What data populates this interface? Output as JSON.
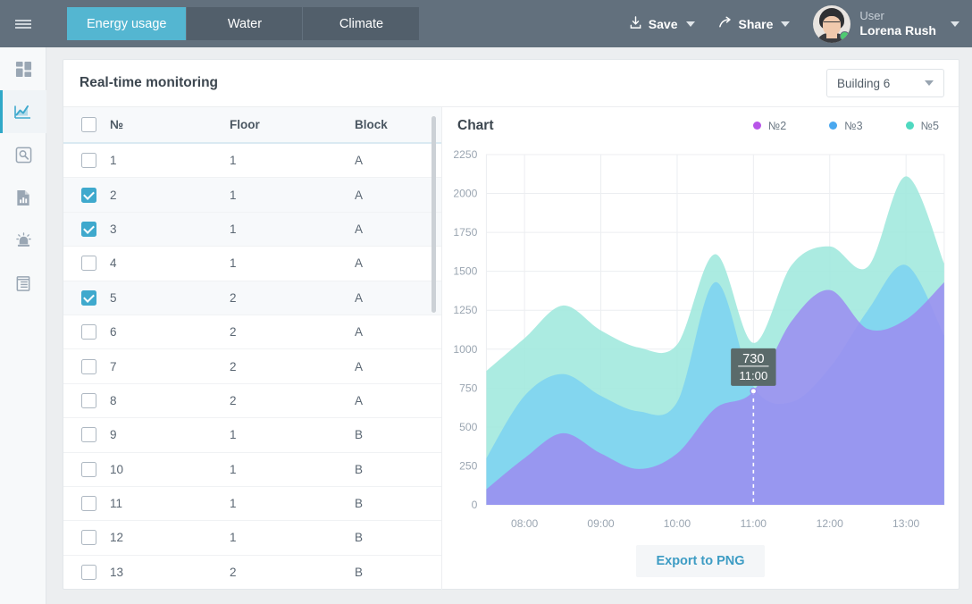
{
  "header": {
    "menu_icon": "hamburger-icon",
    "tabs": [
      {
        "label": "Energy usage",
        "active": true
      },
      {
        "label": "Water",
        "active": false
      },
      {
        "label": "Climate",
        "active": false
      }
    ],
    "save_label": "Save",
    "save_icon": "download-icon",
    "share_label": "Share",
    "share_icon": "share-arrow-icon",
    "user_role": "User",
    "user_name": "Lorena Rush",
    "status": "online"
  },
  "sidebar": {
    "items": [
      {
        "name": "dashboard",
        "icon": "grid-dashboard-icon",
        "active": false
      },
      {
        "name": "analytics",
        "icon": "line-chart-icon",
        "active": true
      },
      {
        "name": "search",
        "icon": "magnifier-search-icon",
        "active": false
      },
      {
        "name": "reports",
        "icon": "document-chart-icon",
        "active": false
      },
      {
        "name": "alerts",
        "icon": "alarm-bell-icon",
        "active": false
      },
      {
        "name": "registry",
        "icon": "list-table-icon",
        "active": false
      }
    ]
  },
  "panel": {
    "title": "Real-time monitoring",
    "building_selected": "Building 6",
    "building_caret": "chevron-down-icon"
  },
  "table": {
    "columns": [
      "№",
      "Floor",
      "Block"
    ],
    "header_checkbox": false,
    "rows": [
      {
        "no": "1",
        "floor": "1",
        "block": "A",
        "checked": false
      },
      {
        "no": "2",
        "floor": "1",
        "block": "A",
        "checked": true
      },
      {
        "no": "3",
        "floor": "1",
        "block": "A",
        "checked": true
      },
      {
        "no": "4",
        "floor": "1",
        "block": "A",
        "checked": false
      },
      {
        "no": "5",
        "floor": "2",
        "block": "A",
        "checked": true
      },
      {
        "no": "6",
        "floor": "2",
        "block": "A",
        "checked": false
      },
      {
        "no": "7",
        "floor": "2",
        "block": "A",
        "checked": false
      },
      {
        "no": "8",
        "floor": "2",
        "block": "A",
        "checked": false
      },
      {
        "no": "9",
        "floor": "1",
        "block": "B",
        "checked": false
      },
      {
        "no": "10",
        "floor": "1",
        "block": "B",
        "checked": false
      },
      {
        "no": "11",
        "floor": "1",
        "block": "B",
        "checked": false
      },
      {
        "no": "12",
        "floor": "1",
        "block": "B",
        "checked": false
      },
      {
        "no": "13",
        "floor": "2",
        "block": "B",
        "checked": false
      }
    ]
  },
  "chart_panel": {
    "title": "Chart",
    "export_label": "Export to PNG"
  },
  "chart_data": {
    "type": "area",
    "title": "Chart",
    "xlabel": "",
    "ylabel": "",
    "ylim": [
      0,
      2250
    ],
    "yticks": [
      0,
      250,
      500,
      750,
      1000,
      1250,
      1500,
      1750,
      2000,
      2250
    ],
    "grid": true,
    "legend_position": "top-right",
    "stacked": false,
    "x": [
      "07:30",
      "08:00",
      "08:30",
      "09:00",
      "09:30",
      "10:00",
      "10:30",
      "11:00",
      "11:30",
      "12:00",
      "12:30",
      "13:00",
      "13:30"
    ],
    "xticks": [
      "08:00",
      "09:00",
      "10:00",
      "11:00",
      "12:00",
      "13:00"
    ],
    "series": [
      {
        "name": "№2",
        "color": "#b855e8",
        "fill": "#9b8ef0",
        "values": [
          100,
          300,
          460,
          330,
          230,
          330,
          620,
          730,
          1180,
          1380,
          1130,
          1190,
          1430
        ]
      },
      {
        "name": "№3",
        "color": "#4aa8ef",
        "fill": "#7dd3f0",
        "values": [
          300,
          700,
          840,
          700,
          600,
          660,
          1430,
          760,
          660,
          880,
          1250,
          1540,
          1090
        ]
      },
      {
        "name": "№5",
        "color": "#4fd9c0",
        "fill": "#9fe8dd",
        "values": [
          860,
          1070,
          1280,
          1120,
          1010,
          1030,
          1610,
          1040,
          1540,
          1660,
          1530,
          2110,
          1550
        ]
      }
    ],
    "tooltip": {
      "value": "730",
      "time": "11:00",
      "series": "№2",
      "x_index": 7
    }
  }
}
